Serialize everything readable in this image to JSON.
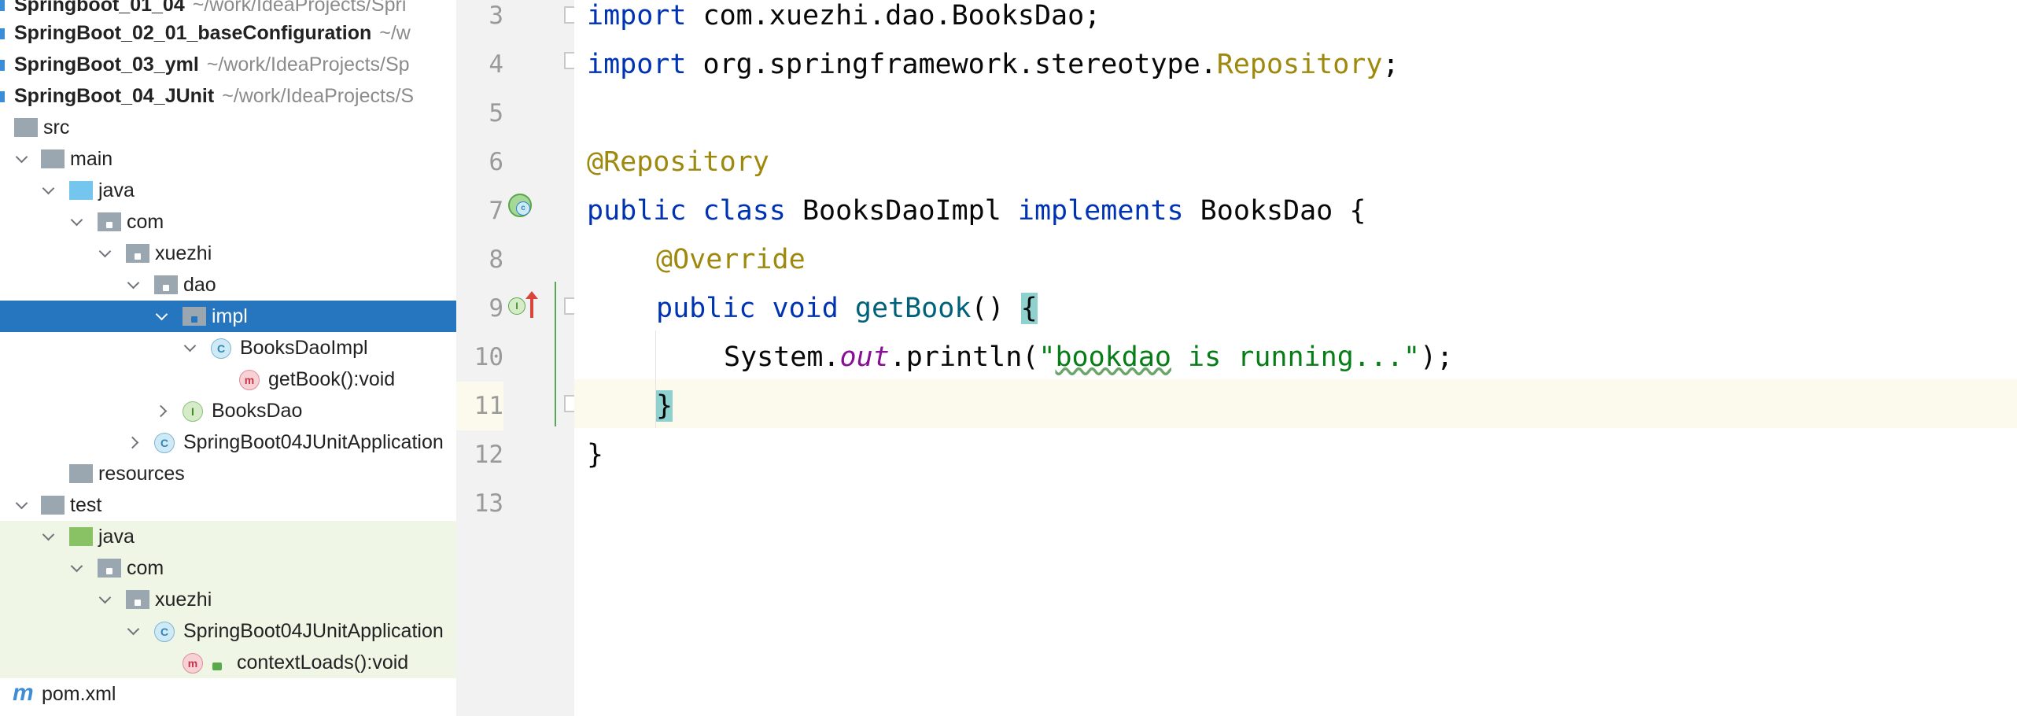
{
  "project_tree": {
    "projects": [
      {
        "name": "Springboot_01_04",
        "path": "~/work/IdeaProjects/Spri"
      },
      {
        "name": "SpringBoot_02_01_baseConfiguration",
        "path": "~/w"
      },
      {
        "name": "SpringBoot_03_yml",
        "path": "~/work/IdeaProjects/Sp"
      },
      {
        "name": "SpringBoot_04_JUnit",
        "path": "~/work/IdeaProjects/S"
      }
    ],
    "nodes": [
      {
        "label": "src"
      },
      {
        "label": "main"
      },
      {
        "label": "java"
      },
      {
        "label": "com"
      },
      {
        "label": "xuezhi"
      },
      {
        "label": "dao"
      },
      {
        "label": "impl"
      },
      {
        "label": "BooksDaoImpl"
      },
      {
        "label": "getBook():void"
      },
      {
        "label": "BooksDao"
      },
      {
        "label": "SpringBoot04JUnitApplication"
      },
      {
        "label": "resources"
      },
      {
        "label": "test"
      },
      {
        "label": "java"
      },
      {
        "label": "com"
      },
      {
        "label": "xuezhi"
      },
      {
        "label": "SpringBoot04JUnitApplication"
      },
      {
        "label": "contextLoads():void"
      },
      {
        "label": "pom.xml"
      }
    ],
    "selected": "impl"
  },
  "editor": {
    "line_numbers": [
      "3",
      "4",
      "5",
      "6",
      "7",
      "8",
      "9",
      "10",
      "11",
      "12",
      "13"
    ],
    "lines": {
      "l3": {
        "kw": "import",
        "rest": " com.xuezhi.dao.BooksDao;"
      },
      "l4": {
        "kw": "import",
        "pre": " org.springframework.stereotype.",
        "ann": "Repository",
        "post": ";"
      },
      "l6": {
        "ann": "@Repository"
      },
      "l7": {
        "kw1": "public",
        "kw2": "class",
        "name": " BooksDaoImpl ",
        "kw3": "implements",
        "rest": " BooksDao {"
      },
      "l8": {
        "ann": "@Override"
      },
      "l9": {
        "kw1": "public",
        "kw2": "void",
        "fn": "getBook",
        "parens": "() ",
        "brace": "{"
      },
      "l10": {
        "pre": "System.",
        "field": "out",
        "call": ".println(",
        "str_q1": "\"",
        "str_word": "bookdao",
        "str_rest": " is running...\"",
        "post": ");"
      },
      "l11": {
        "brace": "}"
      },
      "l12": {
        "brace": "}"
      }
    }
  },
  "colors": {
    "keyword": "#0033b3",
    "annotation": "#9e880d",
    "string": "#067d17",
    "selection": "#2675bf",
    "brace_match": "#8fd1cf",
    "current_line": "#fcfaed"
  }
}
